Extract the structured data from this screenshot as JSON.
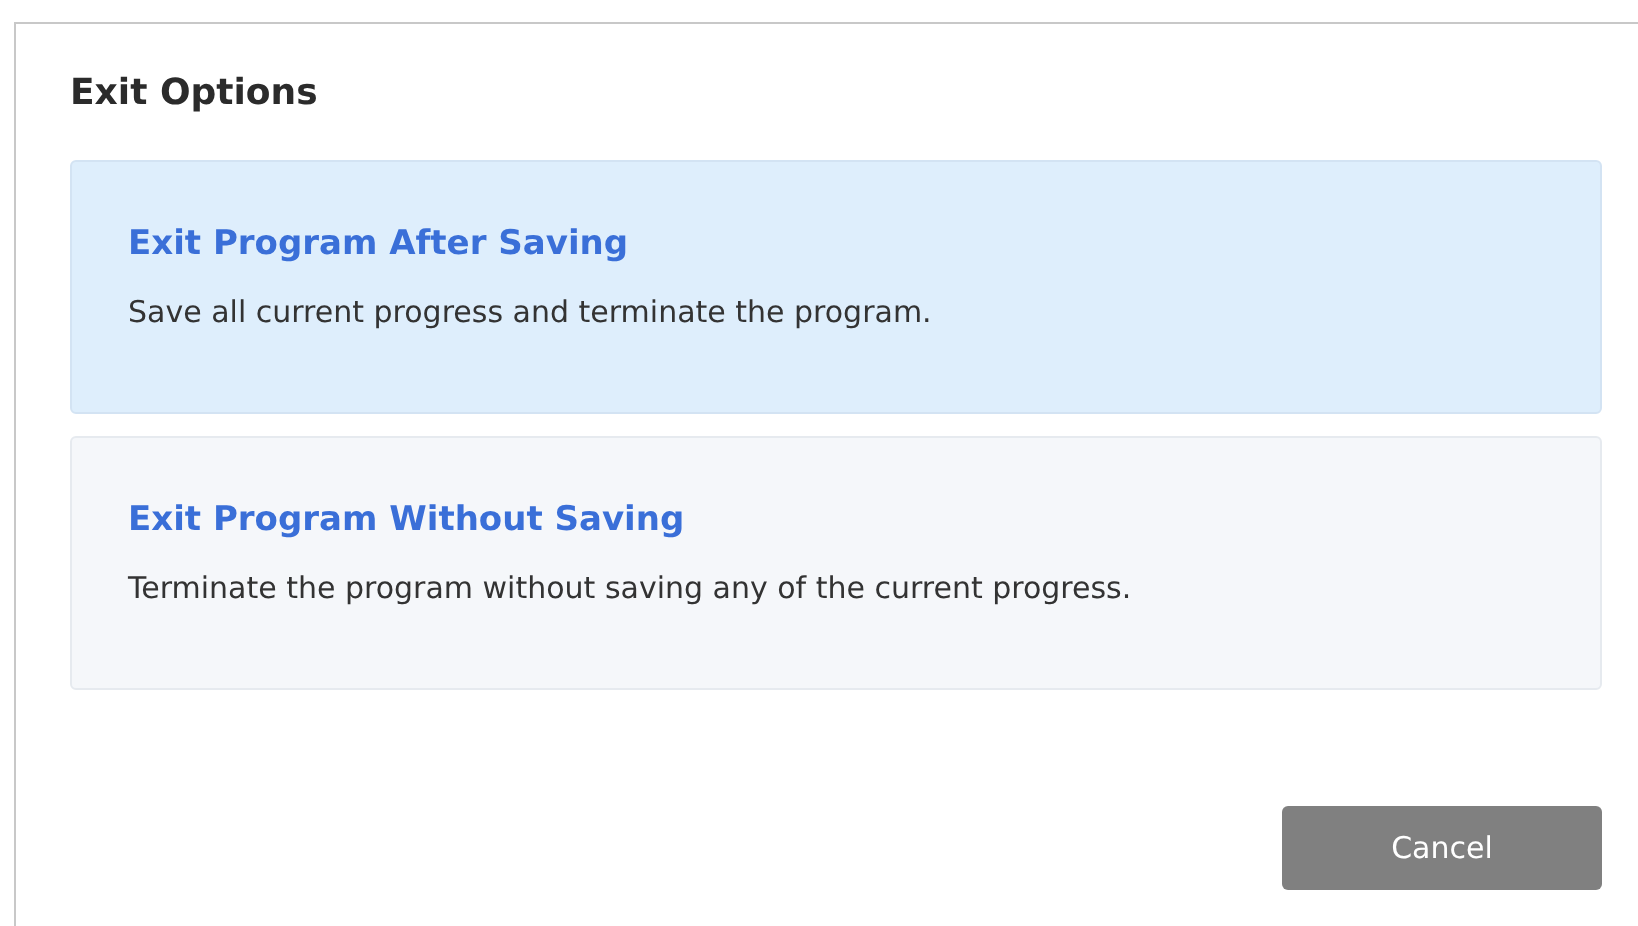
{
  "dialog": {
    "title": "Exit Options"
  },
  "options": [
    {
      "title": "Exit Program After Saving",
      "description": "Save all current progress and terminate the program.",
      "selected": true
    },
    {
      "title": "Exit Program Without Saving",
      "description": "Terminate the program without saving any of the current progress.",
      "selected": false
    }
  ],
  "buttons": [
    "Cancel"
  ]
}
